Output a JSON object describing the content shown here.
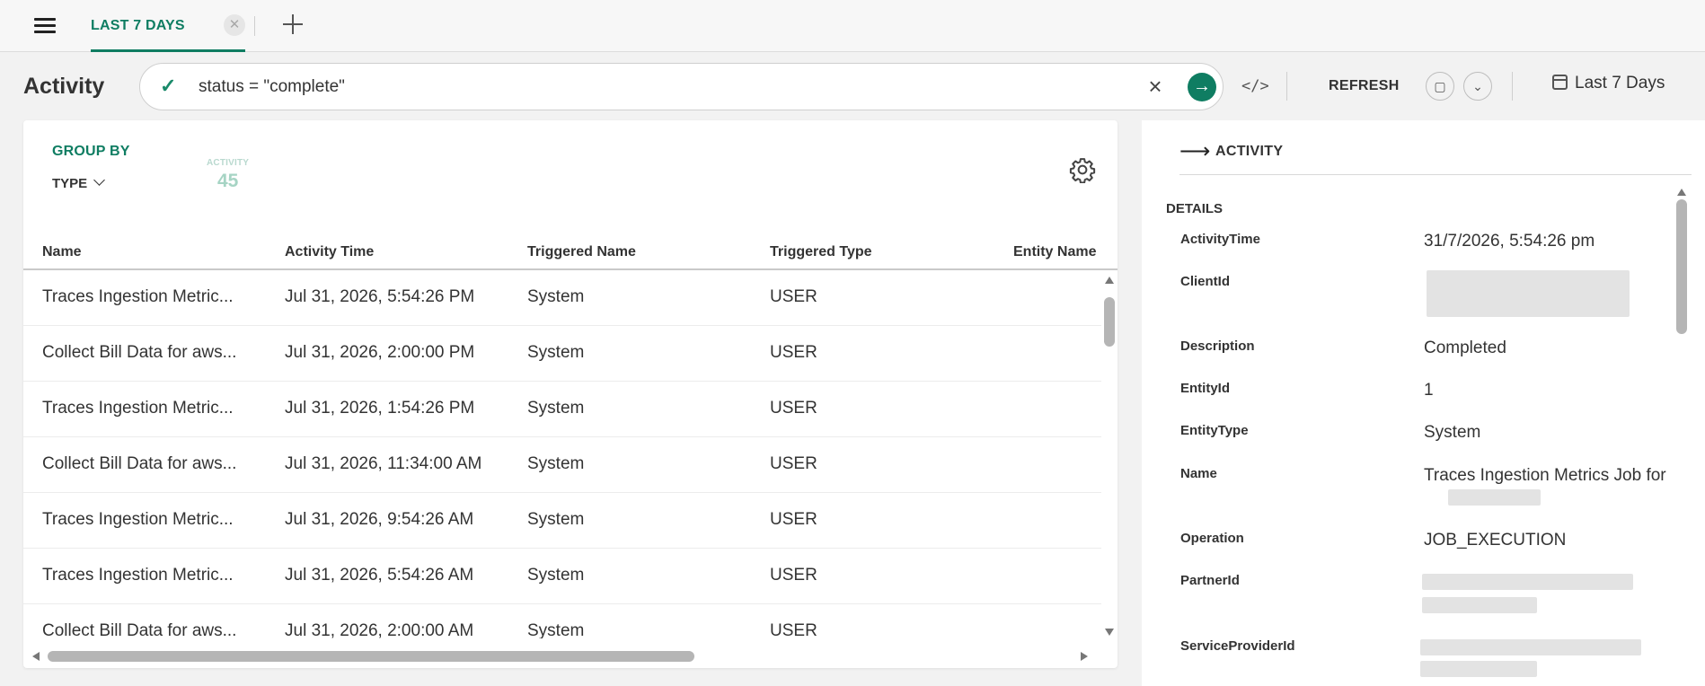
{
  "tabs": [
    {
      "label": "LAST 7 DAYS",
      "active": true
    }
  ],
  "header": {
    "title": "Activity",
    "query": "status = \"complete\"",
    "refresh_label": "REFRESH",
    "date_range_label": "Last 7 Days"
  },
  "colors": {
    "accent": "#0f7d62",
    "metric": "#a6d4c4"
  },
  "group_by": {
    "title": "GROUP BY",
    "selected": "TYPE",
    "metric_label": "ACTIVITY",
    "metric_value": "45"
  },
  "table": {
    "columns": [
      "Name",
      "Activity Time",
      "Triggered Name",
      "Triggered Type",
      "Entity Name"
    ],
    "rows": [
      {
        "name": "Traces Ingestion Metric...",
        "time": "Jul 31, 2026, 5:54:26 PM",
        "triggered_name": "System",
        "triggered_type": "USER"
      },
      {
        "name": "Collect Bill Data for aws...",
        "time": "Jul 31, 2026, 2:00:00 PM",
        "triggered_name": "System",
        "triggered_type": "USER"
      },
      {
        "name": "Traces Ingestion Metric...",
        "time": "Jul 31, 2026, 1:54:26 PM",
        "triggered_name": "System",
        "triggered_type": "USER"
      },
      {
        "name": "Collect Bill Data for aws...",
        "time": "Jul 31, 2026, 11:34:00 AM",
        "triggered_name": "System",
        "triggered_type": "USER"
      },
      {
        "name": "Traces Ingestion Metric...",
        "time": "Jul 31, 2026, 9:54:26 AM",
        "triggered_name": "System",
        "triggered_type": "USER"
      },
      {
        "name": "Traces Ingestion Metric...",
        "time": "Jul 31, 2026, 5:54:26 AM",
        "triggered_name": "System",
        "triggered_type": "USER"
      },
      {
        "name": "Collect Bill Data for aws...",
        "time": "Jul 31, 2026, 2:00:00 AM",
        "triggered_name": "System",
        "triggered_type": "USER"
      }
    ]
  },
  "detail_panel": {
    "title": "ACTIVITY",
    "section_title": "DETAILS",
    "fields": [
      {
        "key": "ActivityTime",
        "value": "31/7/2026, 5:54:26 pm"
      },
      {
        "key": "ClientId",
        "value": ""
      },
      {
        "key": "Description",
        "value": "Completed"
      },
      {
        "key": "EntityId",
        "value": "1"
      },
      {
        "key": "EntityType",
        "value": "System"
      },
      {
        "key": "Name",
        "value": "Traces Ingestion Metrics Job for"
      },
      {
        "key": "Operation",
        "value": "JOB_EXECUTION"
      },
      {
        "key": "PartnerId",
        "value": ""
      },
      {
        "key": "ServiceProviderId",
        "value": ""
      }
    ]
  }
}
